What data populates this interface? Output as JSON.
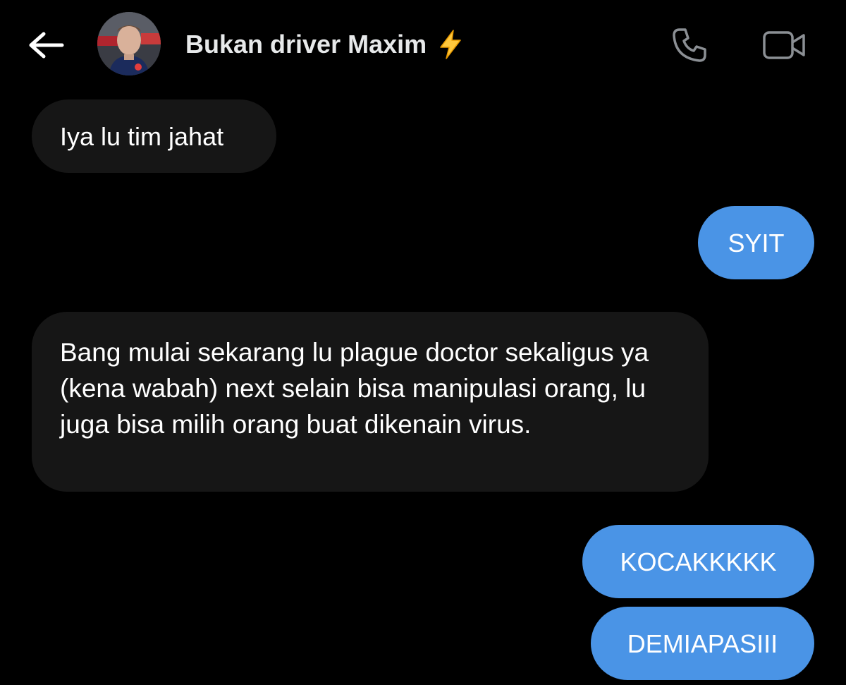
{
  "header": {
    "contact_name": "Bukan driver Maxim",
    "name_emoji": "⚡",
    "back_icon": "arrow-left-icon",
    "call_icon": "phone-icon",
    "video_icon": "video-camera-icon"
  },
  "messages": [
    {
      "direction": "incoming",
      "text": "Iya lu tim jahat"
    },
    {
      "direction": "outgoing",
      "text": "SYIT"
    },
    {
      "direction": "incoming",
      "text": "Bang mulai sekarang lu plague doctor sekaligus ya (kena wabah) next selain bisa manipulasi orang, lu juga bisa milih orang buat dikenain virus."
    },
    {
      "direction": "outgoing",
      "text": "KOCAKKKKK"
    },
    {
      "direction": "outgoing",
      "text": "DEMIAPASIII"
    }
  ],
  "colors": {
    "background": "#000000",
    "incoming_bubble": "#161616",
    "outgoing_bubble": "#4a94e6",
    "header_icons": "#8b8f94",
    "bolt": "#ffc83d"
  }
}
